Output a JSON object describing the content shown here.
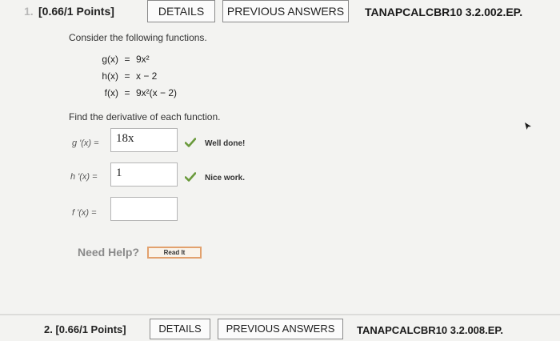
{
  "question1": {
    "number": "1.",
    "points": "[0.66/1 Points]",
    "details_label": "DETAILS",
    "previous_answers_label": "PREVIOUS ANSWERS",
    "problem_code": "TANAPCALCBR10 3.2.002.EP."
  },
  "prompt": {
    "intro": "Consider the following functions.",
    "instruction": "Find the derivative of each function."
  },
  "functions": [
    {
      "lhs": "g(x)",
      "rhs": "9x²"
    },
    {
      "lhs": "h(x)",
      "rhs": "x − 2"
    },
    {
      "lhs": "f(x)",
      "rhs": "9x²(x − 2)"
    }
  ],
  "answers": [
    {
      "label": "g '(x)  =",
      "value": "18x",
      "feedback": "Well done!"
    },
    {
      "label": "h '(x)  =",
      "value": "1",
      "feedback": "Nice work."
    },
    {
      "label": "f '(x)  =",
      "value": ""
    }
  ],
  "help": {
    "need_help": "Need Help?",
    "read_it": "Read It"
  },
  "question2": {
    "points": "2. [0.66/1 Points]",
    "details_label": "DETAILS",
    "previous_answers_label": "PREVIOUS ANSWERS",
    "problem_code": "TANAPCALCBR10 3.2.008.EP."
  },
  "colors": {
    "check_green": "#6a9a3c",
    "read_it_border": "#e2a16e"
  }
}
